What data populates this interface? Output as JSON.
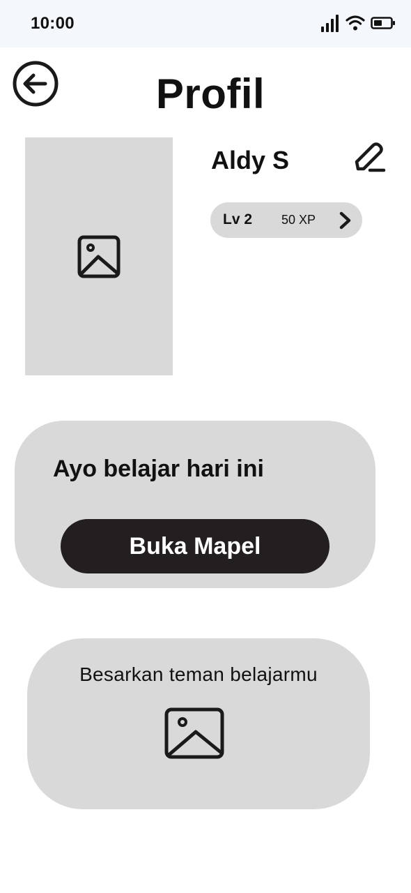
{
  "status_bar": {
    "time": "10:00",
    "icons": [
      "signal-icon",
      "wifi-icon",
      "battery-icon"
    ]
  },
  "header": {
    "back_icon": "arrow-left-circle-icon",
    "title": "Profil"
  },
  "profile": {
    "photo_icon": "image-placeholder-icon",
    "name": "Aldy S",
    "edit_icon": "pencil-icon",
    "level": "Lv 2",
    "xp": "50 XP",
    "chevron_icon": "chevron-right-icon"
  },
  "study_card": {
    "heading": "Ayo belajar hari ini",
    "button_label": "Buka Mapel"
  },
  "buddy_card": {
    "text": "Besarkan teman belajarmu",
    "image_icon": "image-placeholder-icon"
  },
  "colors": {
    "status_bar_bg": "#f4f8fd",
    "card_bg": "#d9d9d9",
    "button_bg": "#231f20",
    "text": "#111111"
  }
}
